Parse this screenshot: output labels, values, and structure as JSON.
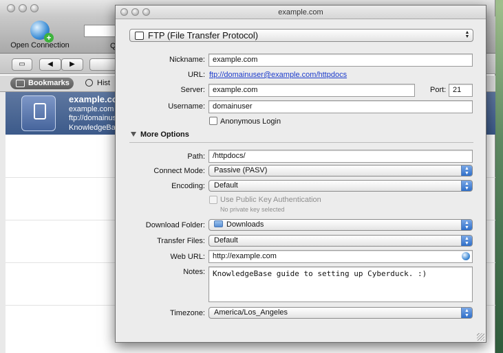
{
  "background_window": {
    "toolbar": {
      "open_connection_label": "Open Connection",
      "quick_connect_label": "Q"
    },
    "tabs": {
      "bookmarks_label": "Bookmarks",
      "history_label": "Hist"
    },
    "bookmark": {
      "title": "example.com",
      "host": "example.com",
      "url": "ftp://domainuser",
      "notes": "KnowledgeBase"
    }
  },
  "dialog": {
    "title": "example.com",
    "protocol": "FTP (File Transfer Protocol)",
    "fields": {
      "nickname_label": "Nickname:",
      "nickname_value": "example.com",
      "url_label": "URL:",
      "url_value": "ftp://domainuser@example.com/httpdocs",
      "server_label": "Server:",
      "server_value": "example.com",
      "port_label": "Port:",
      "port_value": "21",
      "username_label": "Username:",
      "username_value": "domainuser",
      "anonymous_label": "Anonymous Login"
    },
    "more_options": {
      "label": "More Options",
      "path_label": "Path:",
      "path_value": "/httpdocs/",
      "connect_mode_label": "Connect Mode:",
      "connect_mode_value": "Passive (PASV)",
      "encoding_label": "Encoding:",
      "encoding_value": "Default",
      "public_key_label": "Use Public Key Authentication",
      "private_key_note": "No private key selected",
      "download_folder_label": "Download Folder:",
      "download_folder_value": "Downloads",
      "transfer_files_label": "Transfer Files:",
      "transfer_files_value": "Default",
      "web_url_label": "Web URL:",
      "web_url_value": "http://example.com",
      "notes_label": "Notes:",
      "notes_value": "KnowledgeBase guide to setting up Cyberduck. :)",
      "timezone_label": "Timezone:",
      "timezone_value": "America/Los_Angeles"
    }
  }
}
